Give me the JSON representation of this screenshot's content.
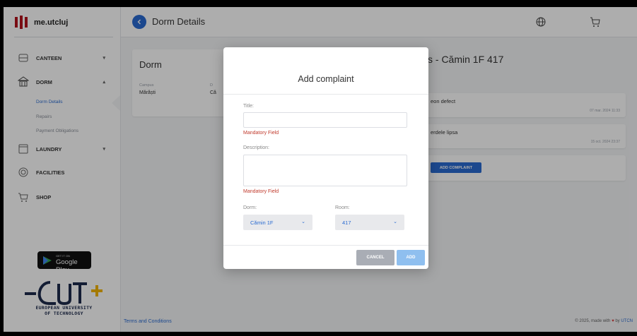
{
  "app": {
    "brand": "me.utcluj"
  },
  "topbar": {
    "title": "Dorm Details",
    "back_icon": "chevron-left-icon"
  },
  "sidebar": {
    "items": [
      {
        "label": "CANTEEN",
        "icon": "canteen-icon",
        "chevron": "▾"
      },
      {
        "label": "DORM",
        "icon": "dorm-icon",
        "chevron": "▴"
      },
      {
        "label": "LAUNDRY",
        "icon": "laundry-icon",
        "chevron": "▾"
      },
      {
        "label": "FACILITIES",
        "icon": "facilities-icon"
      },
      {
        "label": "SHOP",
        "icon": "shop-icon"
      }
    ],
    "sub_items": [
      "Dorm Details",
      "Repairs",
      "Payment Obligations"
    ],
    "store_badge": {
      "small": "GET IT ON",
      "big": "Google Play"
    },
    "eut_text": [
      "EUROPEAN UNIVERSITY",
      "OF TECHNOLOGY"
    ]
  },
  "dorm_card": {
    "title": "Dorm",
    "campus_label": "Campus",
    "campus_value": "Mărăști",
    "col2_label": "D",
    "col2_value": "Că"
  },
  "complaints": {
    "title_fragment": "s - Cămin 1F 417",
    "items": [
      {
        "title": "eon defect",
        "date": "07 mar. 2024 11:33"
      },
      {
        "title": "erdele lipsa",
        "date": "15 oct. 2024 23:37"
      }
    ],
    "add_button": "ADD COMPLAINT"
  },
  "modal": {
    "title": "Add complaint",
    "title_label": "Title:",
    "title_value": "",
    "title_error": "Mandatory Field",
    "description_label": "Description:",
    "description_value": "",
    "description_error": "Mandatory Field",
    "dorm_label": "Dorm:",
    "dorm_value": "Cămin 1F",
    "room_label": "Room:",
    "room_value": "417",
    "cancel": "CANCEL",
    "add": "ADD"
  },
  "footer": {
    "terms": "Terms and Conditions",
    "copyright_pre": "© 2025, made with",
    "copyright_by": "by",
    "copyright_org": "UTCN"
  },
  "colors": {
    "accent": "#2a6bd1",
    "error": "#c0392b",
    "overlay": "rgba(0,0,0,0.32)"
  }
}
